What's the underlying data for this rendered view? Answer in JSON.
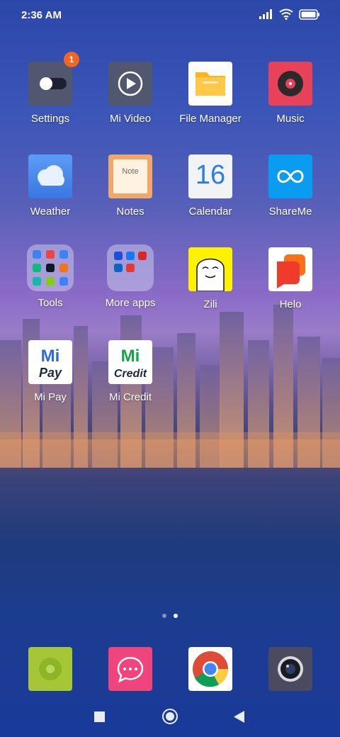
{
  "status_bar": {
    "time": "2:36 AM",
    "icons": [
      "signal-icon",
      "wifi-icon",
      "battery-icon"
    ]
  },
  "apps": {
    "settings": {
      "label": "Settings",
      "badge": "1"
    },
    "mi_video": {
      "label": "Mi Video"
    },
    "file_manager": {
      "label": "File Manager"
    },
    "music": {
      "label": "Music"
    },
    "weather": {
      "label": "Weather"
    },
    "notes": {
      "label": "Notes",
      "icon_text": "Note"
    },
    "calendar": {
      "label": "Calendar",
      "icon_text": "16"
    },
    "shareme": {
      "label": "ShareMe"
    },
    "tools": {
      "label": "Tools"
    },
    "more_apps": {
      "label": "More apps"
    },
    "zili": {
      "label": "Zili"
    },
    "helo": {
      "label": "Helo"
    },
    "mi_pay": {
      "label": "Mi Pay"
    },
    "mi_credit": {
      "label": "Mi Credit"
    }
  },
  "pager": {
    "pages": 2,
    "current": 2
  },
  "dock": [
    "phone-dialer-icon",
    "messages-icon",
    "chrome-icon",
    "camera-icon"
  ],
  "navigation": [
    "recents-button",
    "home-button",
    "back-button"
  ],
  "colors": {
    "badge": "#f26522",
    "music": "#e8415a",
    "shareme": "#0a9cf0",
    "file_manager": "#ffc13a",
    "messages": "#f0457a",
    "phone": "#a4c637"
  }
}
